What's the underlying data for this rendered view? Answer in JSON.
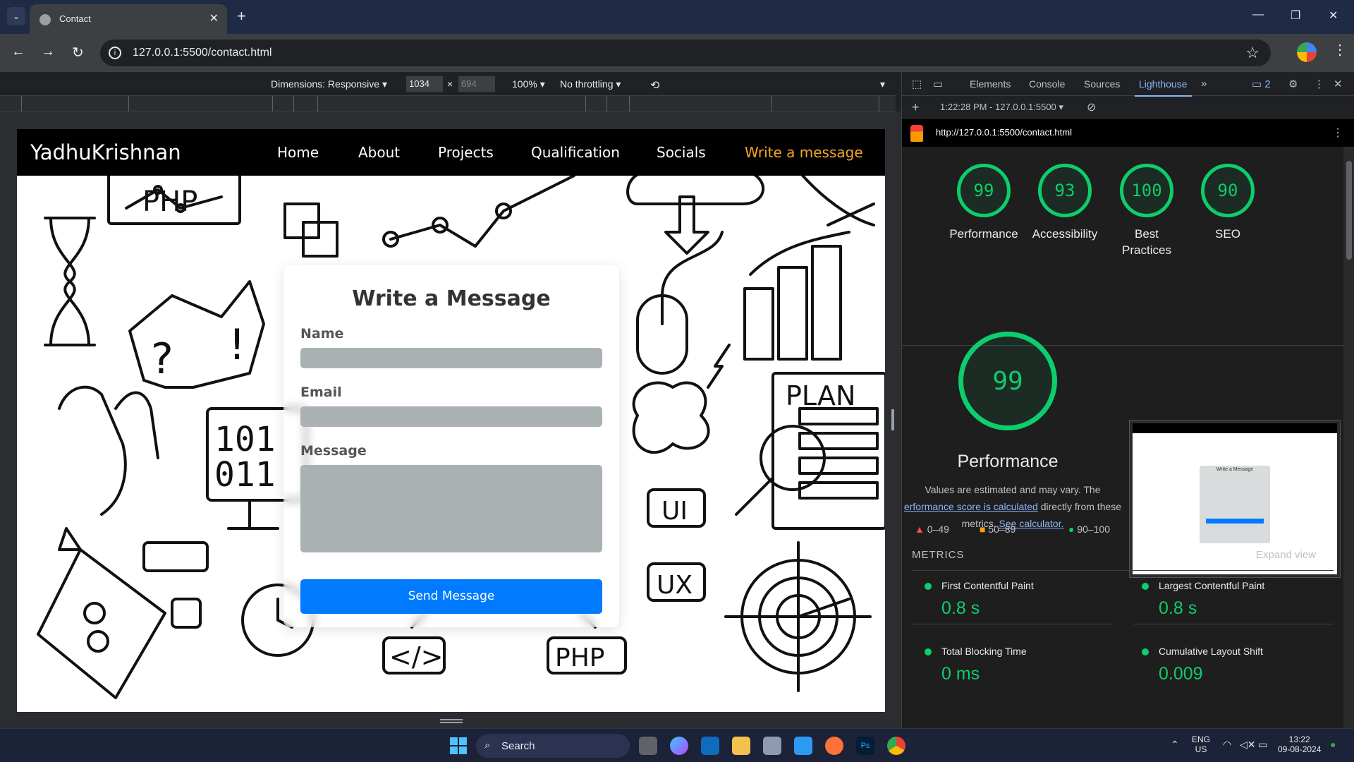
{
  "browser": {
    "tab_title": "Contact",
    "url": "127.0.0.1:5500/contact.html"
  },
  "device_toolbar": {
    "dimensions_label": "Dimensions: Responsive",
    "width": "1034",
    "height_placeholder": "694",
    "times": "×",
    "zoom": "100%",
    "throttling": "No throttling"
  },
  "site": {
    "brand": "YadhuKrishnan",
    "nav": [
      "Home",
      "About",
      "Projects",
      "Qualification",
      "Socials",
      "Write a message"
    ],
    "form": {
      "title": "Write a Message",
      "name_label": "Name",
      "email_label": "Email",
      "message_label": "Message",
      "send_label": "Send Message"
    },
    "doodle_text": {
      "php_top": "PHP",
      "plan": "PLAN",
      "binary_1": "101",
      "binary_2": "011",
      "ui": "UI",
      "ux": "UX",
      "code": "</>",
      "php_bottom": "PHP"
    }
  },
  "devtools": {
    "tabs": [
      "Elements",
      "Console",
      "Sources",
      "Lighthouse"
    ],
    "active_tab": "Lighthouse",
    "issues_count": "2",
    "report_select": "1:22:28 PM - 127.0.0.1:5500",
    "report_url": "http://127.0.0.1:5500/contact.html",
    "scores": [
      {
        "value": "99",
        "label": "Performance"
      },
      {
        "value": "93",
        "label": "Accessibility"
      },
      {
        "value": "100",
        "label": "Best Practices"
      },
      {
        "value": "90",
        "label": "SEO"
      }
    ],
    "performance": {
      "score": "99",
      "title": "Performance",
      "desc_1": "Values are estimated and may vary. The",
      "desc_link_1": "erformance score is calculated",
      "desc_2": "directly from these",
      "desc_3": "metrics.",
      "desc_link_2": "See calculator."
    },
    "legend": [
      "0–49",
      "50–89",
      "90–100"
    ],
    "metrics_heading": "METRICS",
    "expand_view": "Expand view",
    "metrics": [
      {
        "name": "First Contentful Paint",
        "value": "0.8 s"
      },
      {
        "name": "Largest Contentful Paint",
        "value": "0.8 s"
      },
      {
        "name": "Total Blocking Time",
        "value": "0 ms"
      },
      {
        "name": "Cumulative Layout Shift",
        "value": "0.009"
      }
    ],
    "thumbnail_title": "Write a Message"
  },
  "taskbar": {
    "search_label": "Search",
    "lang_1": "ENG",
    "lang_2": "US",
    "time": "13:22",
    "date": "09-08-2024"
  },
  "colors": {
    "accent_nav": "#f5a623",
    "send_button": "#007bff",
    "score_green": "#0cce6b",
    "devtools_link": "#8ab4f8"
  }
}
